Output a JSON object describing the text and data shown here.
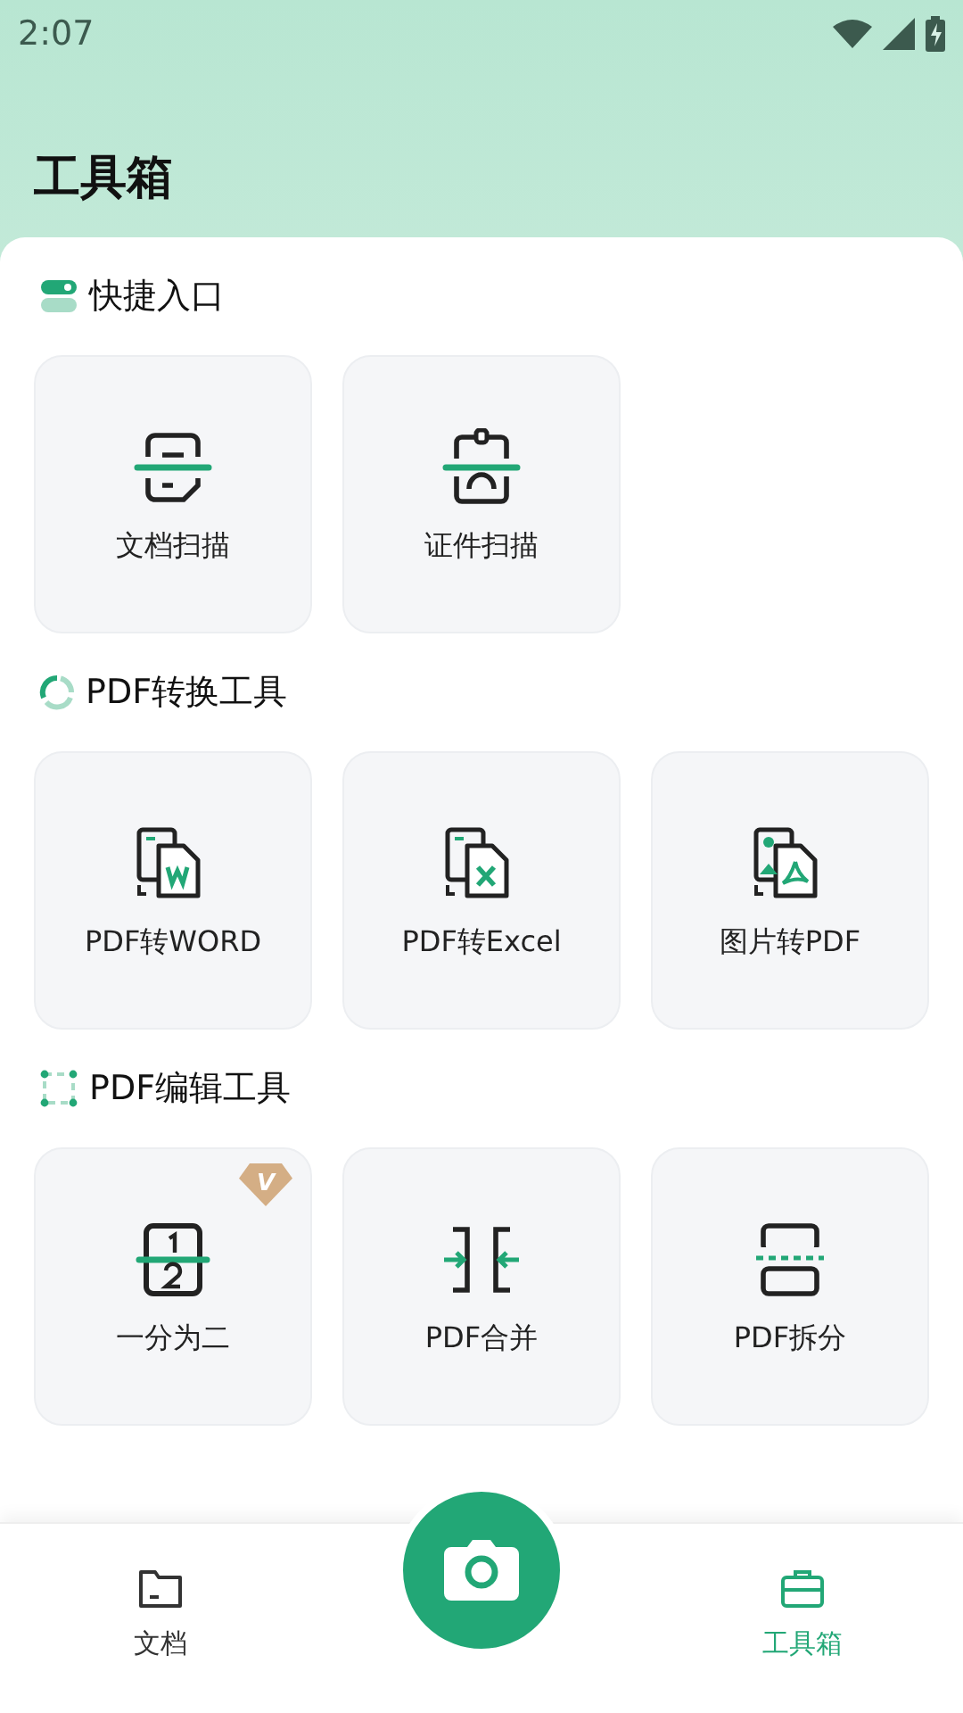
{
  "status_bar": {
    "time": "2:07"
  },
  "title": "工具箱",
  "sections": [
    {
      "title": "快捷入口",
      "kind": "toggle",
      "tiles": [
        {
          "label": "文档扫描",
          "kind": "doc-scan"
        },
        {
          "label": "证件扫描",
          "kind": "id-scan"
        }
      ]
    },
    {
      "title": "PDF转换工具",
      "kind": "ring",
      "tiles": [
        {
          "label": "PDF转WORD",
          "kind": "word"
        },
        {
          "label": "PDF转Excel",
          "kind": "excel"
        },
        {
          "label": "图片转PDF",
          "kind": "image-pdf"
        }
      ]
    },
    {
      "title": "PDF编辑工具",
      "kind": "frame",
      "tiles": [
        {
          "label": "一分为二",
          "kind": "split-half",
          "badge": "V"
        },
        {
          "label": "PDF合并",
          "kind": "merge"
        },
        {
          "label": "PDF拆分",
          "kind": "split"
        }
      ]
    }
  ],
  "nav": [
    {
      "label": "文档",
      "kind": "folder",
      "selected": false
    },
    {
      "label": "工具箱",
      "kind": "toolbox",
      "selected": true
    }
  ]
}
